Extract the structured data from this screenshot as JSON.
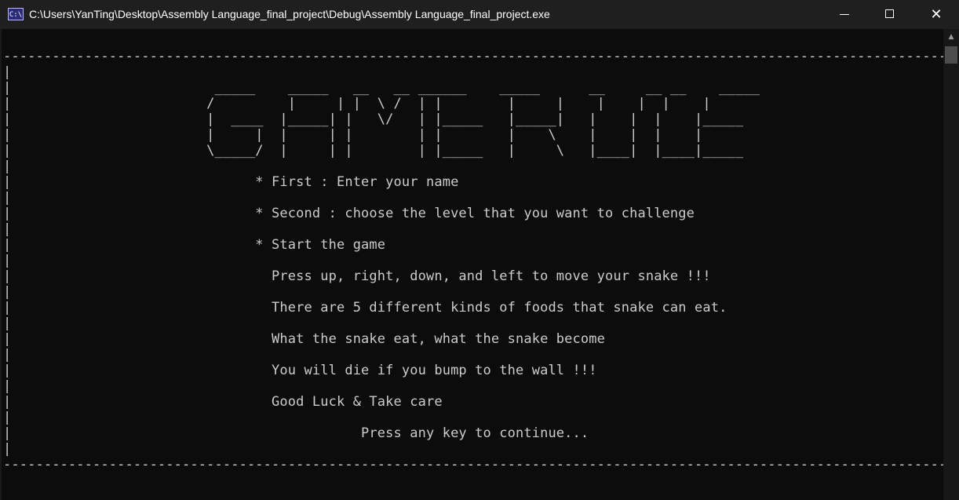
{
  "window": {
    "title": "C:\\Users\\YanTing\\Desktop\\Assembly Language_final_project\\Debug\\Assembly Language_final_project.exe",
    "icon_label": "C:\\",
    "minimize_icon": "minimize-icon",
    "maximize_icon": "maximize-icon",
    "close_icon": "close-icon",
    "close_glyph": "✕"
  },
  "console": {
    "border_top": "---------------------------------------------------------------------------------------------------------------------------------------",
    "border_bottom": "---------------------------------------------------------------------------------------------------------------------------------------",
    "banner_lines": [
      "   _____    _____   __   __ ______    _____      __     __ __    _____",
      "  /         |     | |  \\ /  | |        |     |    |    |  |    |",
      "  |  ____  |_____| |   \\/   | |_____   |_____|   |    |  |    |_____",
      "  |     |  |     | |        | |        |    \\    |    |  |    |",
      "  \\_____/  |     | |        | |_____   |     \\   |____|  |____|_____"
    ],
    "rules": [
      "* First : Enter your name",
      "* Second : choose the level that you want to challenge",
      "* Start the game",
      "  Press up, right, down, and left to move your snake !!!",
      "  There are 5 different kinds of foods that snake can eat.",
      "  What the snake eat, what the snake become",
      "  You will die if you bump to the wall !!!",
      "  Good Luck & Take care"
    ],
    "prompt": "Press any key to continue..."
  },
  "scrollbar": {
    "up_arrow": "▲"
  },
  "colors": {
    "console_bg": "#0c0c0c",
    "console_text": "#cccccc",
    "titlebar_bg": "#1f1f1f"
  }
}
